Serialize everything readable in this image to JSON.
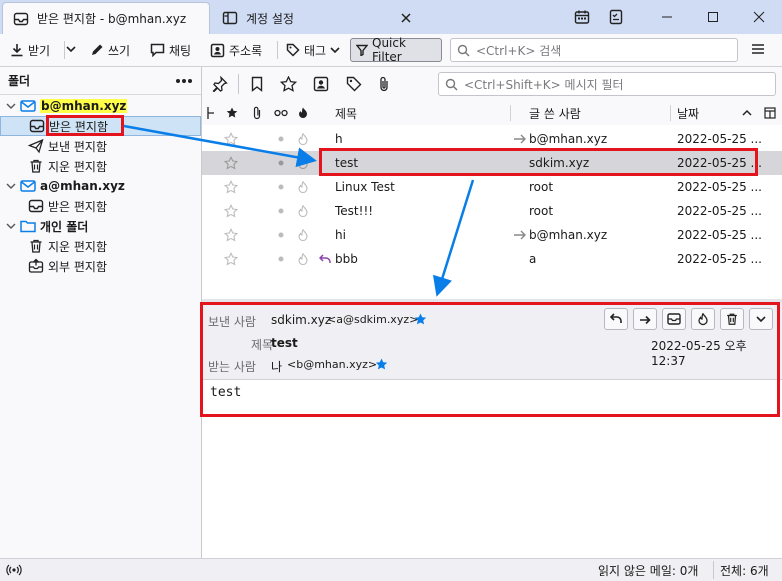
{
  "tabs": [
    {
      "label": "받은 편지함 - b@mhan.xyz",
      "icon": "inbox-icon"
    },
    {
      "label": "계정 설정",
      "icon": "account-settings-icon"
    }
  ],
  "toolbar": {
    "get_mail": "받기",
    "write": "쓰기",
    "chat": "채팅",
    "address_book": "주소록",
    "tag": "태그",
    "quick_filter": "Quick Filter",
    "search_placeholder": "<Ctrl+K> 검색"
  },
  "folder_pane": {
    "header": "폴더",
    "accounts": [
      {
        "name": "b@mhan.xyz",
        "highlighted": true,
        "folders": [
          {
            "label": "받은 편지함",
            "icon": "inbox-icon",
            "selected": true
          },
          {
            "label": "보낸 편지함",
            "icon": "sent-icon"
          },
          {
            "label": "지운 편지함",
            "icon": "trash-icon"
          }
        ]
      },
      {
        "name": "a@mhan.xyz",
        "folders": [
          {
            "label": "받은 편지함",
            "icon": "inbox-icon"
          }
        ]
      },
      {
        "name": "개인 폴더",
        "folders": [
          {
            "label": "지운 편지함",
            "icon": "trash-icon"
          },
          {
            "label": "외부 편지함",
            "icon": "outbox-icon"
          }
        ]
      }
    ]
  },
  "message_list": {
    "filter_placeholder": "<Ctrl+Shift+K> 메시지 필터",
    "columns": {
      "subject": "제목",
      "author": "글 쓴 사람",
      "date": "날짜"
    },
    "rows": [
      {
        "subject": "h",
        "author": "b@mhan.xyz",
        "date": "2022-05-25 ...",
        "forwarded": true
      },
      {
        "subject": "test",
        "author": "sdkim.xyz",
        "date": "2022-05-25 ...",
        "selected": true
      },
      {
        "subject": "Linux Test",
        "author": "root",
        "date": "2022-05-25 ..."
      },
      {
        "subject": "Test!!!",
        "author": "root",
        "date": "2022-05-25 ..."
      },
      {
        "subject": "hi",
        "author": "b@mhan.xyz",
        "date": "2022-05-25 ...",
        "forwarded": true
      },
      {
        "subject": "bbb",
        "author": "a",
        "date": "2022-05-25 ...",
        "replied": true
      }
    ]
  },
  "preview": {
    "from_label": "보낸 사람",
    "from_name": "sdkim.xyz",
    "from_email": "<a@sdkim.xyz>",
    "subject_label": "제목",
    "subject": "test",
    "date": "2022-05-25 오후 12:37",
    "to_label": "받는 사람",
    "to_name": "나",
    "to_email": "<b@mhan.xyz>",
    "body": "test"
  },
  "statusbar": {
    "unread": "읽지 않은 메일: 0개",
    "total": "전체: 6개"
  },
  "colors": {
    "accent": "#0a7ee8",
    "annotation_red": "#e3141c",
    "highlight_yellow": "#ffff4a",
    "replied_purple": "#8e44ad"
  }
}
